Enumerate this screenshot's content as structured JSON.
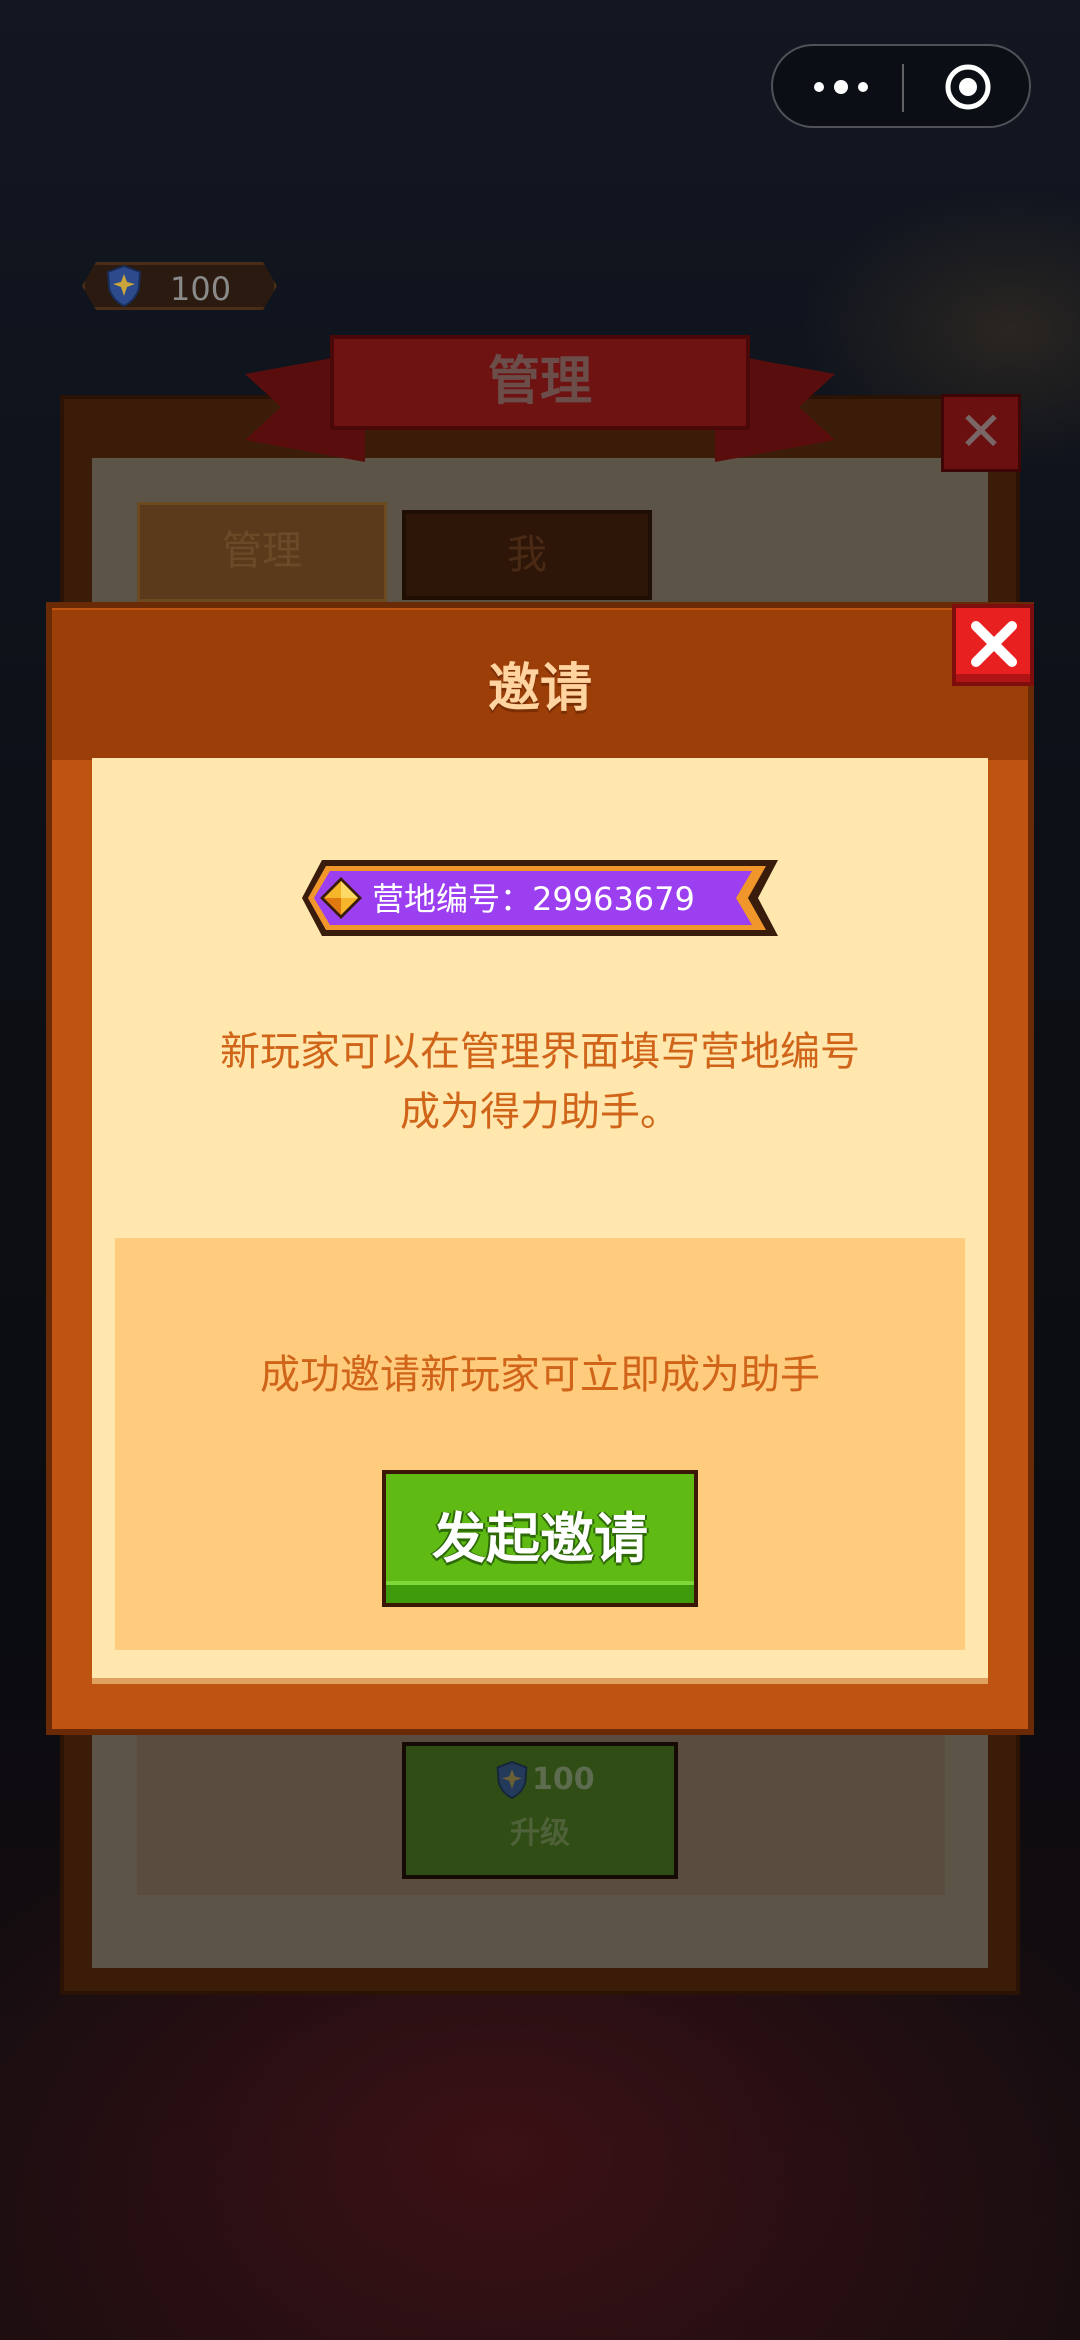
{
  "top_menu": {
    "more_icon": "more-dots-icon",
    "target_icon": "target-icon"
  },
  "currency": {
    "icon": "shield-icon",
    "value": "100"
  },
  "background_panel": {
    "title": "管理",
    "tabs": [
      {
        "label": "管理"
      },
      {
        "label": "我"
      }
    ],
    "upgrade": {
      "cost": "100",
      "label": "升级"
    },
    "close_icon": "close-icon"
  },
  "dialog": {
    "title": "邀请",
    "close_icon": "close-icon",
    "camp_id": "营地编号：29963679",
    "description_line1": "新玩家可以在管理界面填写营地编号",
    "description_line2": "成为得力助手。",
    "invite_hint": "成功邀请新玩家可立即成为助手",
    "invite_button": "发起邀请"
  },
  "colors": {
    "dialog_frame": "#bf5312",
    "dialog_body": "#ffe7ad",
    "invite_box": "#ffcc7d",
    "text_orange": "#d0651a",
    "button_green": "#5fbb14",
    "badge_purple": "#9b3ff0"
  }
}
